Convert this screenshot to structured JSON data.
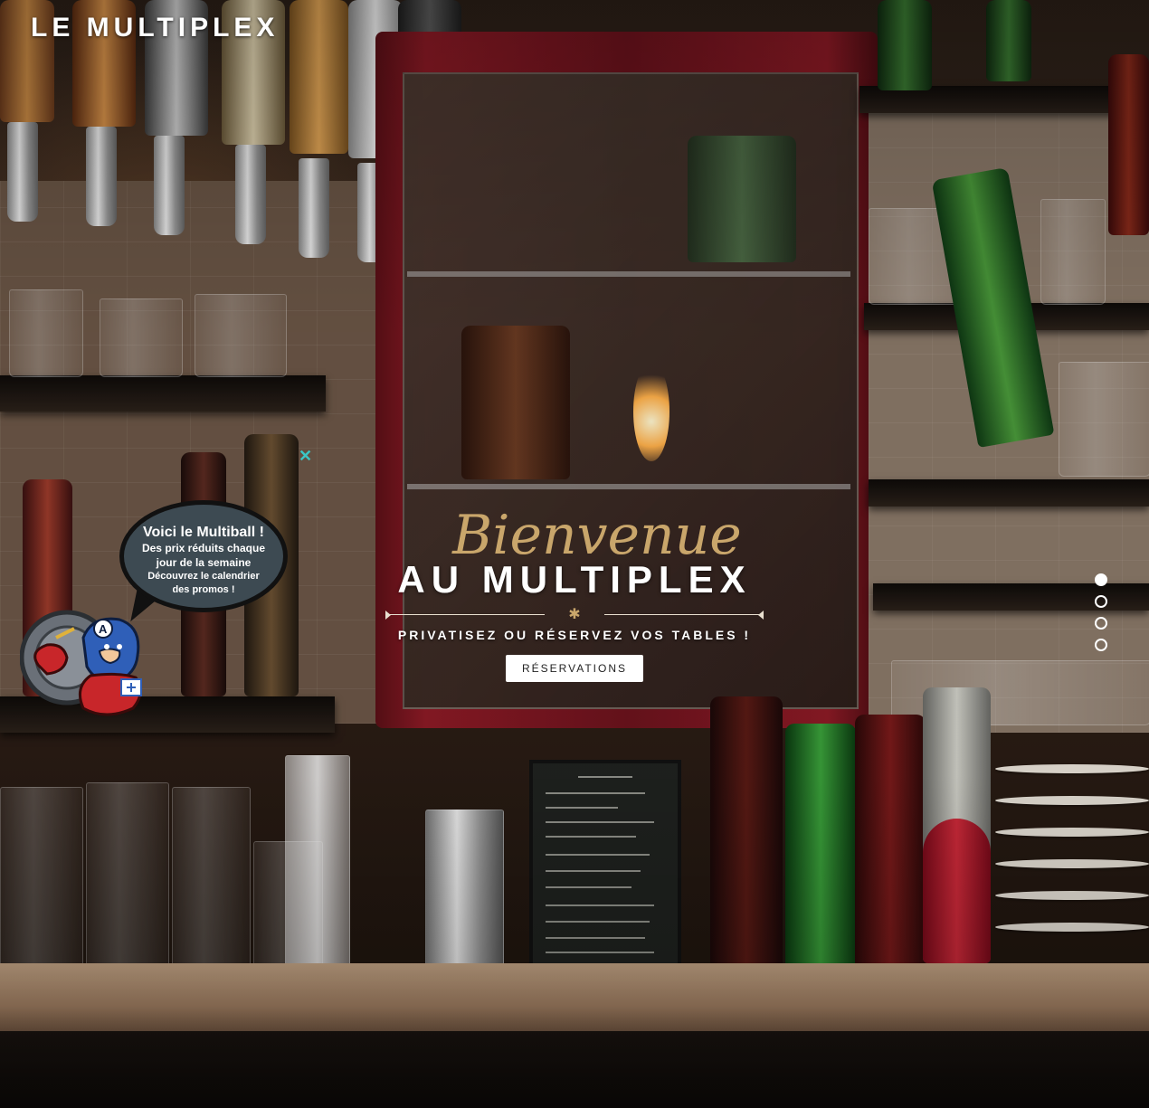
{
  "site": {
    "logo": "LE MULTIPLEX"
  },
  "hero": {
    "script_title": "Bienvenue",
    "title": "AU MULTIPLEX",
    "divider_icon": "star-icon",
    "tagline": "PRIVATISEZ OU RÉSERVEZ VOS TABLES !",
    "cta_label": "RÉSERVATIONS"
  },
  "slider": {
    "slides": 4,
    "active_index": 0
  },
  "promo": {
    "close_icon": "close-icon",
    "title": "Voici le Multiball !",
    "line1": "Des prix réduits chaque",
    "line2": "jour de la semaine",
    "line3": "Découvrez le calendrier",
    "line4": "des promos !",
    "mascot": "superhero-mascot-icon"
  },
  "colors": {
    "accent_gold": "#c9a66b",
    "close_teal": "#3ac6c6",
    "bubble_bg": "#3d4a52"
  }
}
